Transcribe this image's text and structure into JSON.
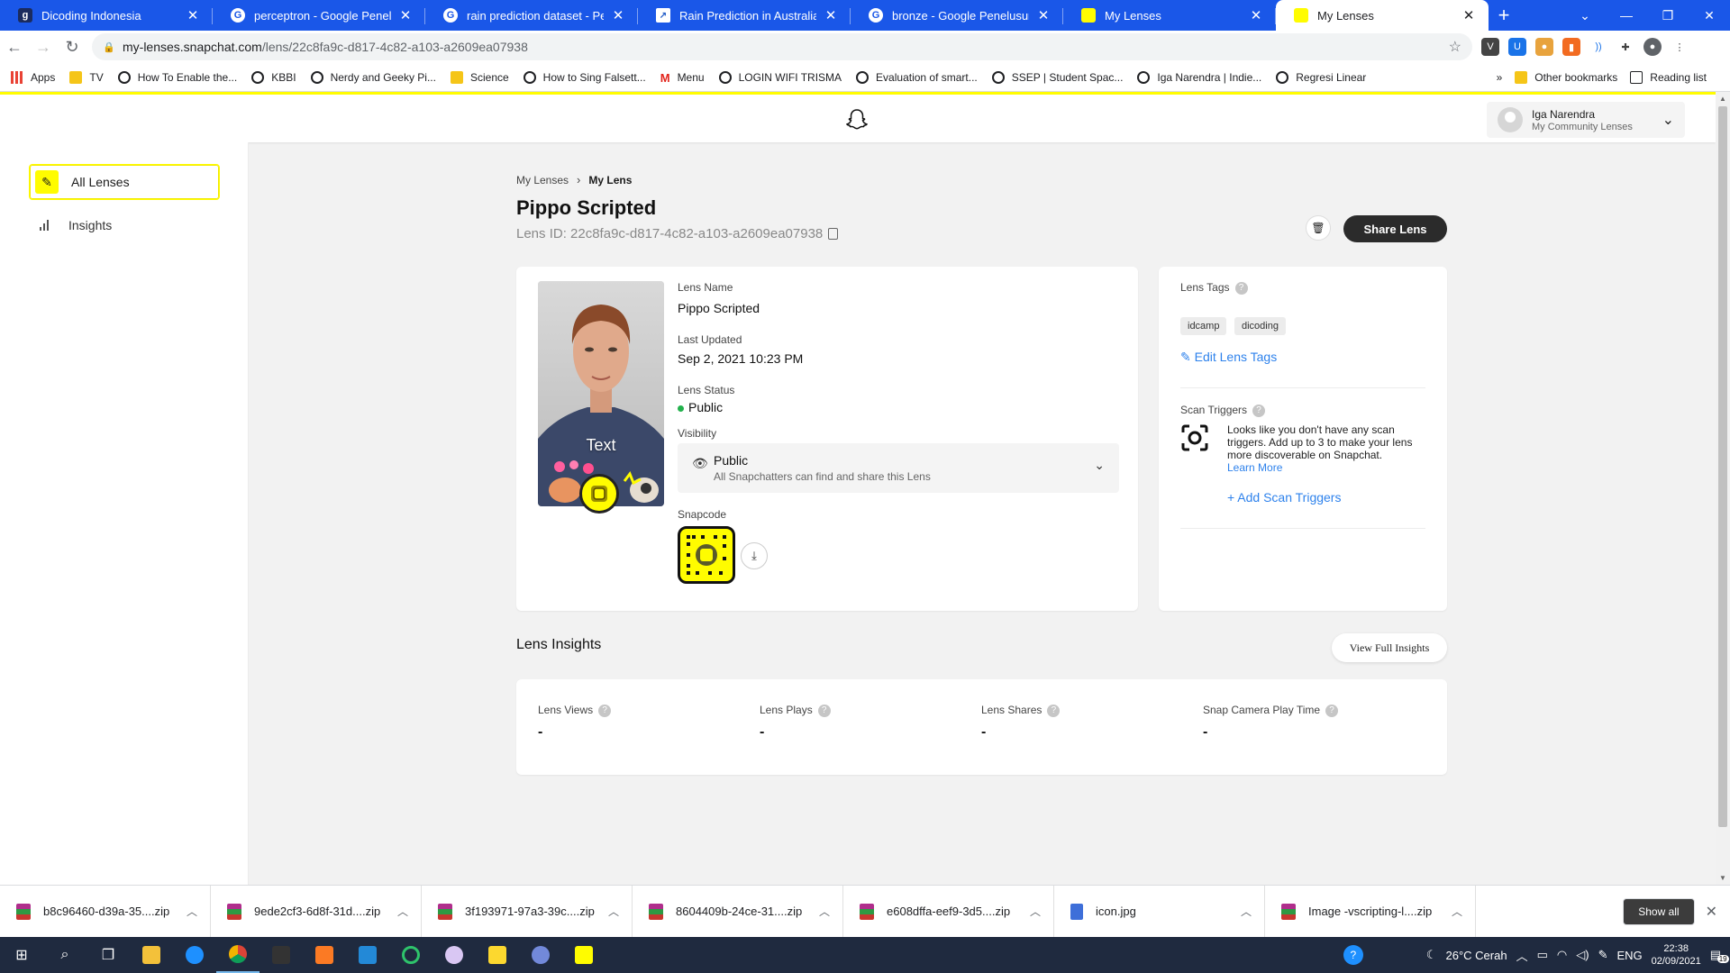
{
  "browser": {
    "tabs": [
      {
        "title": "Dicoding Indonesia",
        "favicon": "dicoding-icon",
        "active": false
      },
      {
        "title": "perceptron - Google Penelusuran",
        "favicon": "google-icon",
        "active": false
      },
      {
        "title": "rain prediction dataset - Penelu",
        "favicon": "google-icon",
        "active": false
      },
      {
        "title": "Rain Prediction in Australia | Pre",
        "favicon": "chart-icon",
        "active": false
      },
      {
        "title": "bronze - Google Penelusuran",
        "favicon": "google-icon",
        "active": false
      },
      {
        "title": "My Lenses",
        "favicon": "snapchat-icon",
        "active": false
      },
      {
        "title": "My Lenses",
        "favicon": "snapchat-icon",
        "active": true
      }
    ],
    "url_host": "my-lenses.snapchat.com",
    "url_path": "/lens/22c8fa9c-d817-4c82-a103-a2609ea07938",
    "bookmarks": [
      "Apps",
      "TV",
      "How To Enable the...",
      "KBBI",
      "Nerdy and Geeky Pi...",
      "Science",
      "How to Sing Falsett...",
      "Menu",
      "LOGIN WIFI TRISMA",
      "Evaluation of smart...",
      "SSEP | Student Spac...",
      "Iga Narendra | Indie...",
      "Regresi Linear"
    ],
    "bookmarks_overflow": "»",
    "other_bookmarks": "Other bookmarks",
    "reading_list": "Reading list"
  },
  "header": {
    "user_name": "Iga Narendra",
    "user_sub": "My Community Lenses"
  },
  "sidebar": {
    "all_lenses": "All Lenses",
    "insights": "Insights"
  },
  "breadcrumb": {
    "parent": "My Lenses",
    "current": "My Lens"
  },
  "lens": {
    "title": "Pippo Scripted",
    "id_label": "Lens ID: 22c8fa9c-d817-4c82-a103-a2609ea07938",
    "share_label": "Share Lens",
    "preview_text": "Text",
    "name_label": "Lens Name",
    "name_value": "Pippo Scripted",
    "updated_label": "Last Updated",
    "updated_value": "Sep 2, 2021 10:23 PM",
    "status_label": "Lens Status",
    "status_value": "Public",
    "status_color": "#22b14c",
    "visibility_label": "Visibility",
    "visibility_value": "Public",
    "visibility_desc": "All Snapchatters can find and share this Lens",
    "snapcode_label": "Snapcode"
  },
  "tags": {
    "label": "Lens Tags",
    "items": [
      "idcamp",
      "dicoding"
    ],
    "edit_label": "Edit Lens Tags",
    "scan_label": "Scan Triggers",
    "scan_text": "Looks like you don't have any scan triggers. Add up to 3 to make your lens more discoverable on Snapchat.",
    "learn_more": "Learn More",
    "add_scan": "Add Scan Triggers"
  },
  "insights": {
    "title": "Lens Insights",
    "full_button": "View Full Insights",
    "metrics": [
      {
        "label": "Lens Views",
        "value": "-"
      },
      {
        "label": "Lens Plays",
        "value": "-"
      },
      {
        "label": "Lens Shares",
        "value": "-"
      },
      {
        "label": "Snap Camera Play Time",
        "value": "-"
      }
    ]
  },
  "downloads": {
    "items": [
      "b8c96460-d39a-35....zip",
      "9ede2cf3-6d8f-31d....zip",
      "3f193971-97a3-39c....zip",
      "8604409b-24ce-31....zip",
      "e608dffa-eef9-3d5....zip",
      "icon.jpg",
      "Image -vscripting-l....zip"
    ],
    "show_all": "Show all"
  },
  "taskbar": {
    "weather": "26°C  Cerah",
    "lang": "ENG",
    "time": "22:38",
    "date": "02/09/2021",
    "notifications": "19"
  },
  "colors": {
    "brand_yellow": "#fffc00",
    "link_blue": "#2e82ec",
    "chrome_blue": "#1a57e8"
  }
}
